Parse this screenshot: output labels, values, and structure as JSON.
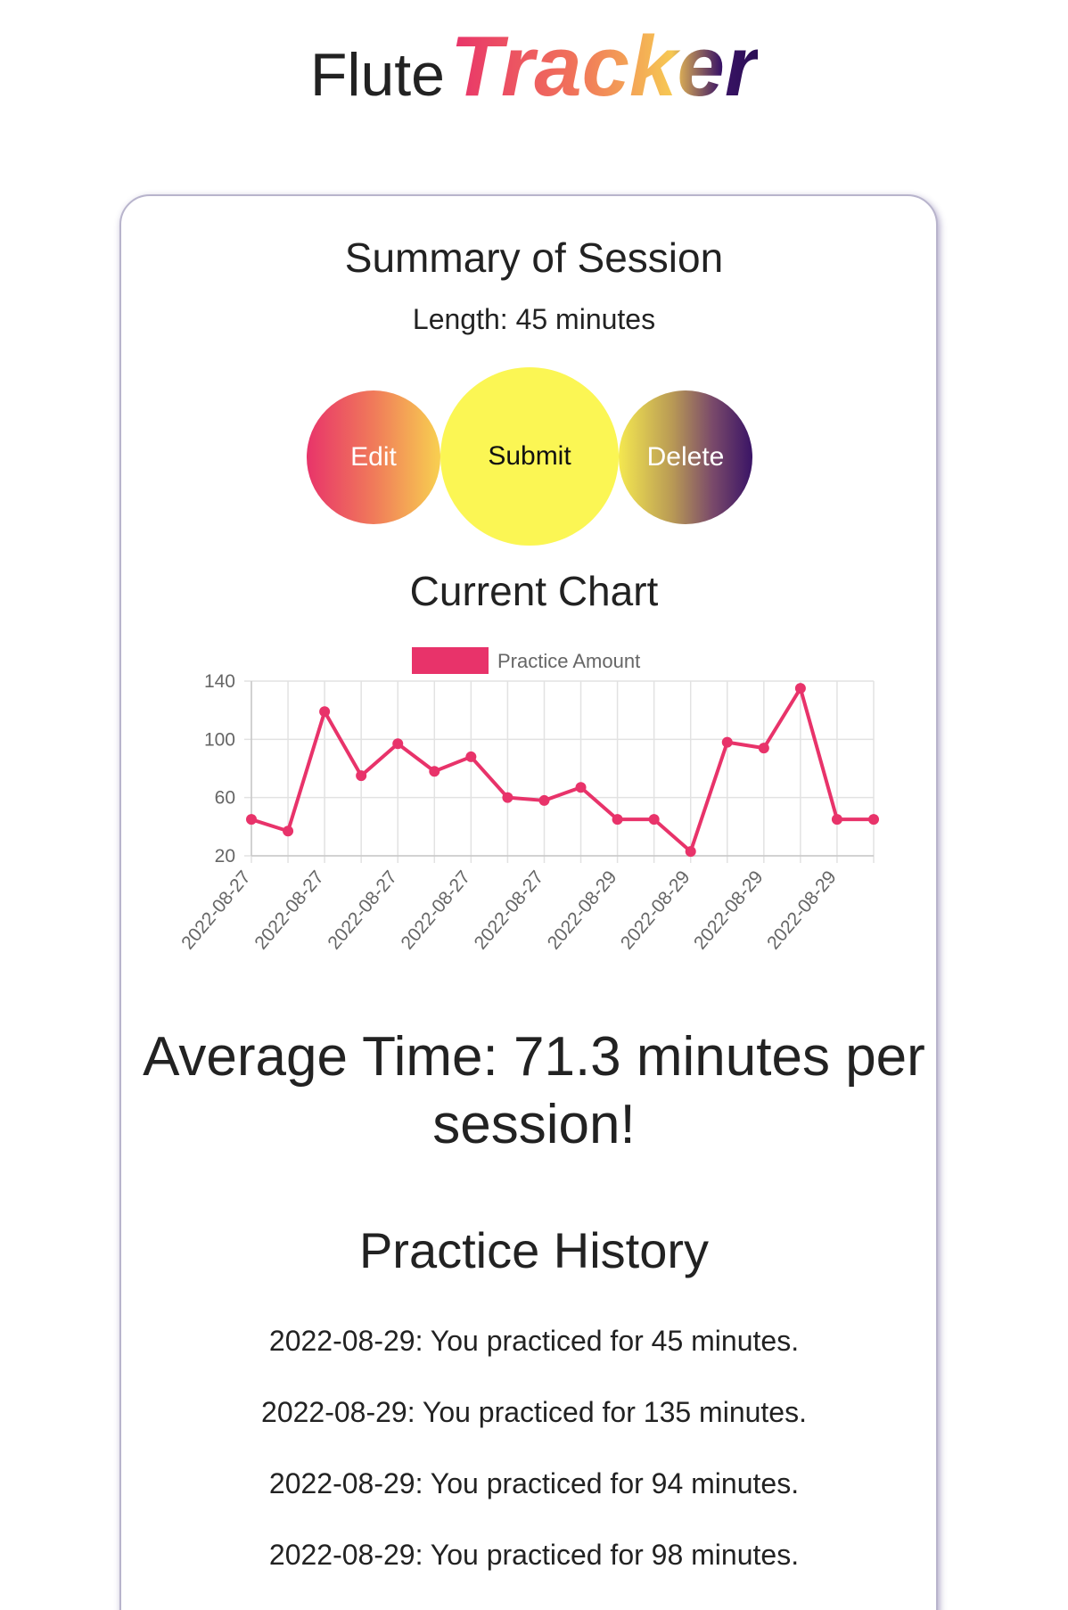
{
  "brand": {
    "part1": "Flute",
    "part2": "Tracker"
  },
  "session": {
    "title": "Summary of Session",
    "length_text": "Length: 45 minutes"
  },
  "buttons": {
    "edit": "Edit",
    "submit": "Submit",
    "delete": "Delete"
  },
  "chart_section_title": "Current Chart",
  "chart_data": {
    "type": "line",
    "legend": [
      "Practice Amount"
    ],
    "legend_position": "top-center",
    "grid": true,
    "series": [
      {
        "name": "Practice Amount",
        "color": "#e8336a",
        "values": [
          45,
          37,
          119,
          75,
          97,
          78,
          88,
          60,
          58,
          67,
          45,
          45,
          23,
          98,
          94,
          135,
          45,
          45
        ]
      }
    ],
    "x_tick_labels": [
      "2022-08-27",
      "2022-08-27",
      "2022-08-27",
      "2022-08-27",
      "2022-08-27",
      "2022-08-29",
      "2022-08-29",
      "2022-08-29",
      "2022-08-29"
    ],
    "y_ticks": [
      20,
      60,
      100,
      140
    ],
    "ylim": [
      20,
      140
    ]
  },
  "average_text": "Average Time: 71.3 minutes per session!",
  "history": {
    "title": "Practice History",
    "entries": [
      "2022-08-29: You practiced for 45 minutes.",
      "2022-08-29: You practiced for 135 minutes.",
      "2022-08-29: You practiced for 94 minutes.",
      "2022-08-29: You practiced for 98 minutes."
    ]
  }
}
